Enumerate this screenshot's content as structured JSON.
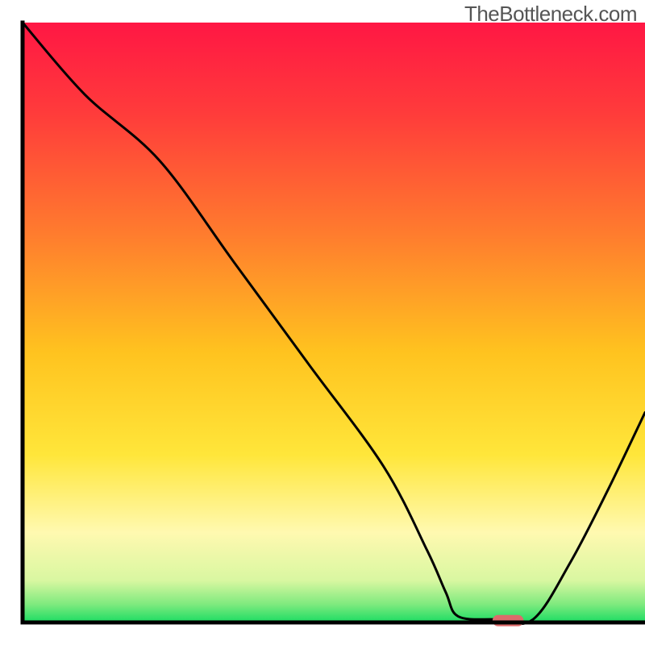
{
  "brand": "TheBottleneck.com",
  "chart_data": {
    "type": "line",
    "title": "",
    "xlabel": "",
    "ylabel": "",
    "xlim": [
      0,
      100
    ],
    "ylim": [
      0,
      100
    ],
    "x": [
      0,
      10,
      22,
      34,
      46,
      58,
      65,
      68,
      70,
      76,
      82,
      88,
      94,
      100
    ],
    "values": [
      100,
      88,
      77,
      60,
      43,
      26,
      12,
      5,
      1,
      0.5,
      0.5,
      10,
      22,
      35
    ],
    "curve_description": "Bottleneck percentage curve; starts near 100% on the left, descends with an inflection around x≈22, reaches a minimum near x≈76–82 (optimal zone, near-zero bottleneck), then rises again toward the right.",
    "optimal_marker": {
      "x_center": 78,
      "x_width": 5,
      "y": 0.3,
      "color": "#dd6b6b"
    },
    "background_gradient": {
      "type": "vertical",
      "stops": [
        {
          "pos": 0.0,
          "color": "#ff1744"
        },
        {
          "pos": 0.15,
          "color": "#ff3b3b"
        },
        {
          "pos": 0.35,
          "color": "#ff7b2e"
        },
        {
          "pos": 0.55,
          "color": "#ffc31f"
        },
        {
          "pos": 0.72,
          "color": "#ffe63a"
        },
        {
          "pos": 0.85,
          "color": "#fff9b0"
        },
        {
          "pos": 0.93,
          "color": "#d9f7a1"
        },
        {
          "pos": 0.97,
          "color": "#7eea7e"
        },
        {
          "pos": 1.0,
          "color": "#1bdc63"
        }
      ]
    },
    "axes": {
      "color": "#000000",
      "width": 5
    }
  }
}
